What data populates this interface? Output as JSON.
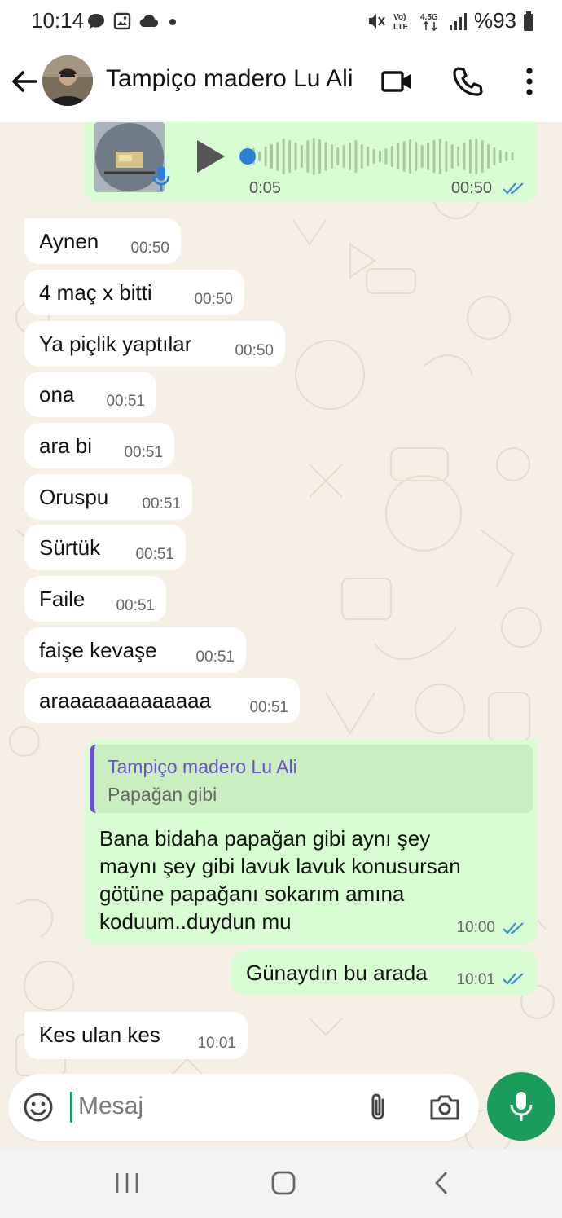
{
  "status_bar": {
    "time": "10:14",
    "network_volte": "Vo) LTE",
    "network_type": "4.5G",
    "battery": "%93"
  },
  "header": {
    "contact_name": "Tampiço madero Lu Ali",
    "icons": [
      "back-arrow-icon",
      "video-call-icon",
      "phone-icon",
      "more-vert-icon"
    ]
  },
  "voice_message": {
    "progress": 0.0,
    "duration": "0:05",
    "time": "00:50"
  },
  "messages": [
    {
      "dir": "in",
      "text": "Aynen",
      "time": "00:50"
    },
    {
      "dir": "in",
      "text": "4 maç x bitti",
      "time": "00:50"
    },
    {
      "dir": "in",
      "text": "Ya piçlik yaptılar",
      "time": "00:50"
    },
    {
      "dir": "in",
      "text": "ona",
      "time": "00:51"
    },
    {
      "dir": "in",
      "text": "ara bi",
      "time": "00:51"
    },
    {
      "dir": "in",
      "text": "Oruspu",
      "time": "00:51"
    },
    {
      "dir": "in",
      "text": "Sürtük",
      "time": "00:51"
    },
    {
      "dir": "in",
      "text": "Faile",
      "time": "00:51"
    },
    {
      "dir": "in",
      "text": "faişe kevaşe",
      "time": "00:51"
    },
    {
      "dir": "in",
      "text": "araaaaaaaaaaaaa",
      "time": "00:51"
    }
  ],
  "reply_message": {
    "quoted_author": "Tampiço madero Lu Ali",
    "quoted_text": "Papağan gibi",
    "lines": [
      "Bana bidaha papağan gibi aynı şey",
      "maynı şey gibi lavuk lavuk konusursan",
      "götüne papağanı sokarım amına",
      "koduum..duydun mu"
    ],
    "time": "10:00"
  },
  "out_message": {
    "text": "Günaydın bu arada",
    "time": "10:01"
  },
  "last_in_message": {
    "text": "Kes ulan kes",
    "time": "10:01"
  },
  "input": {
    "placeholder": "Mesaj",
    "value": ""
  },
  "colors": {
    "accent": "#1a9c5a",
    "out_bubble": "#d8fdd2",
    "in_bubble": "#ffffff",
    "chat_bg": "#f5efe6",
    "read_ticks": "#3b8fd6",
    "quote_author": "#6b4fd0"
  }
}
